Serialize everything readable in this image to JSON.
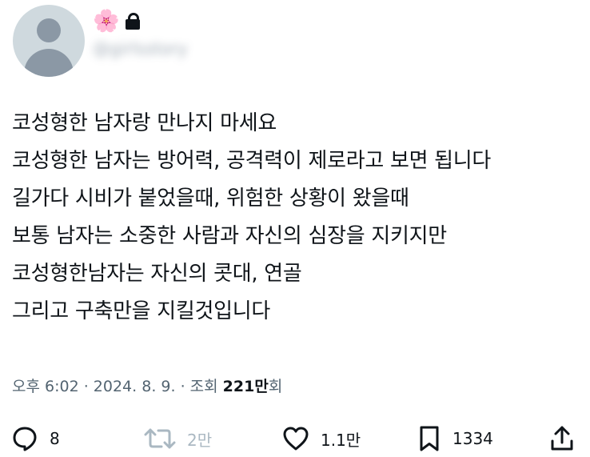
{
  "author": {
    "emoji": "🌸",
    "handle": "@girlsstory"
  },
  "post": {
    "lines": [
      "코성형한 남자랑 만나지 마세요",
      "코성형한 남자는 방어력, 공격력이 제로라고 보면 됩니다",
      "길가다 시비가 붙었을때, 위험한 상황이 왔을때",
      "보통 남자는 소중한 사람과 자신의 심장을 지키지만",
      "코성형한남자는 자신의 콧대, 연골",
      "그리고 구축만을 지킬것입니다"
    ]
  },
  "meta": {
    "time": "오후 6:02",
    "sep1": " · ",
    "date": "2024. 8. 9.",
    "sep2": " · ",
    "views_label": "조회 ",
    "views_value": "221만",
    "views_suffix": "회"
  },
  "actions": {
    "reply_count": "8",
    "repost_count": "2만",
    "like_count": "1.1만",
    "bookmark_count": "1334"
  },
  "icons": {
    "reply": "reply-icon",
    "repost": "repost-icon",
    "like": "heart-icon",
    "bookmark": "bookmark-icon",
    "share": "share-icon"
  }
}
